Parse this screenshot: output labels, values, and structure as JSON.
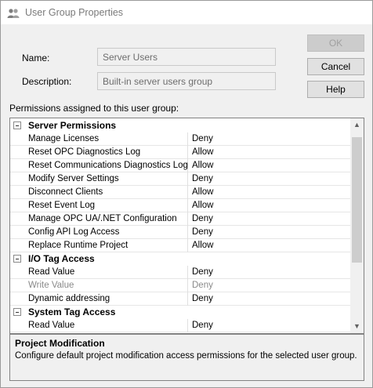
{
  "window": {
    "title": "User Group Properties"
  },
  "form": {
    "name_label": "Name:",
    "name_value": "Server Users",
    "description_label": "Description:",
    "description_value": "Built-in server users group",
    "permissions_label": "Permissions assigned to this user group:"
  },
  "buttons": {
    "ok": "OK",
    "cancel": "Cancel",
    "help": "Help"
  },
  "permissions": [
    {
      "category": "Server Permissions",
      "items": [
        {
          "name": "Manage Licenses",
          "value": "Deny",
          "enabled": true
        },
        {
          "name": "Reset OPC Diagnostics Log",
          "value": "Allow",
          "enabled": true
        },
        {
          "name": "Reset Communications Diagnostics Log",
          "value": "Allow",
          "enabled": true
        },
        {
          "name": "Modify Server Settings",
          "value": "Deny",
          "enabled": true
        },
        {
          "name": "Disconnect Clients",
          "value": "Allow",
          "enabled": true
        },
        {
          "name": "Reset Event Log",
          "value": "Allow",
          "enabled": true
        },
        {
          "name": "Manage OPC UA/.NET Configuration",
          "value": "Deny",
          "enabled": true
        },
        {
          "name": "Config API Log Access",
          "value": "Deny",
          "enabled": true
        },
        {
          "name": "Replace Runtime Project",
          "value": "Allow",
          "enabled": true
        }
      ]
    },
    {
      "category": "I/O Tag Access",
      "items": [
        {
          "name": "Read Value",
          "value": "Deny",
          "enabled": true
        },
        {
          "name": "Write Value",
          "value": "Deny",
          "enabled": false
        },
        {
          "name": "Dynamic addressing",
          "value": "Deny",
          "enabled": true
        }
      ]
    },
    {
      "category": "System Tag Access",
      "items": [
        {
          "name": "Read Value",
          "value": "Deny",
          "enabled": true
        }
      ]
    }
  ],
  "description_panel": {
    "title": "Project Modification",
    "text": "Configure default project modification access permissions for the selected user group."
  }
}
